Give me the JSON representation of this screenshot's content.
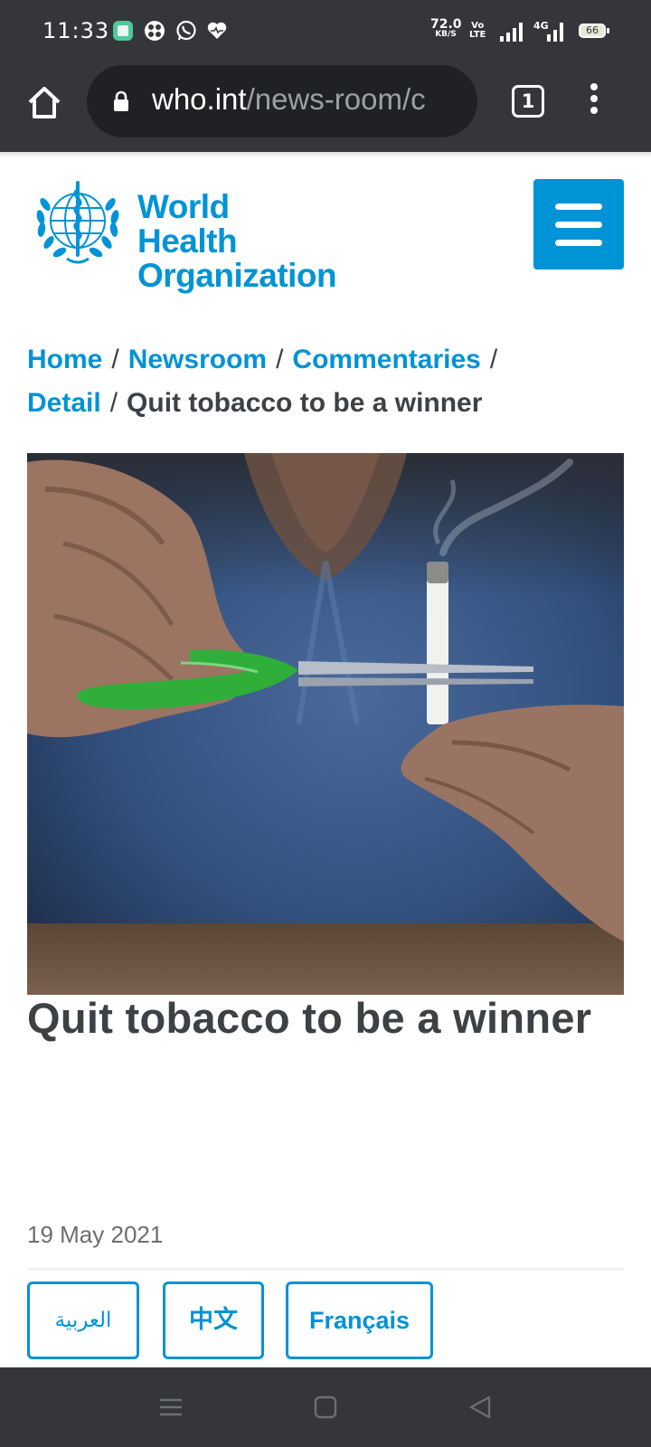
{
  "status_bar": {
    "time": "11:33",
    "net_speed_value": "72.0",
    "net_speed_unit": "KB/S",
    "volte_top": "Vo",
    "volte_bottom": "LTE",
    "network_type": "4G",
    "battery": "66",
    "app_icons": [
      "gallery-icon",
      "app-grid-icon",
      "whatsapp-icon",
      "health-heart-icon"
    ]
  },
  "browser": {
    "url_host": "who.int",
    "url_path": "/news-room/c",
    "tab_count": "1"
  },
  "header": {
    "logo_line1": "World Health",
    "logo_line2": "Organization"
  },
  "breadcrumb": {
    "items": [
      "Home",
      "Newsroom",
      "Commentaries",
      "Detail"
    ],
    "separator": "/",
    "current": "Quit tobacco to be a winner"
  },
  "article": {
    "title": "Quit tobacco to be a winner",
    "date": "19 May 2021",
    "languages": [
      "العربية",
      "中文",
      "Français"
    ]
  },
  "colors": {
    "accent": "#0093d5",
    "chrome": "#35363a",
    "text": "#3c4146"
  }
}
